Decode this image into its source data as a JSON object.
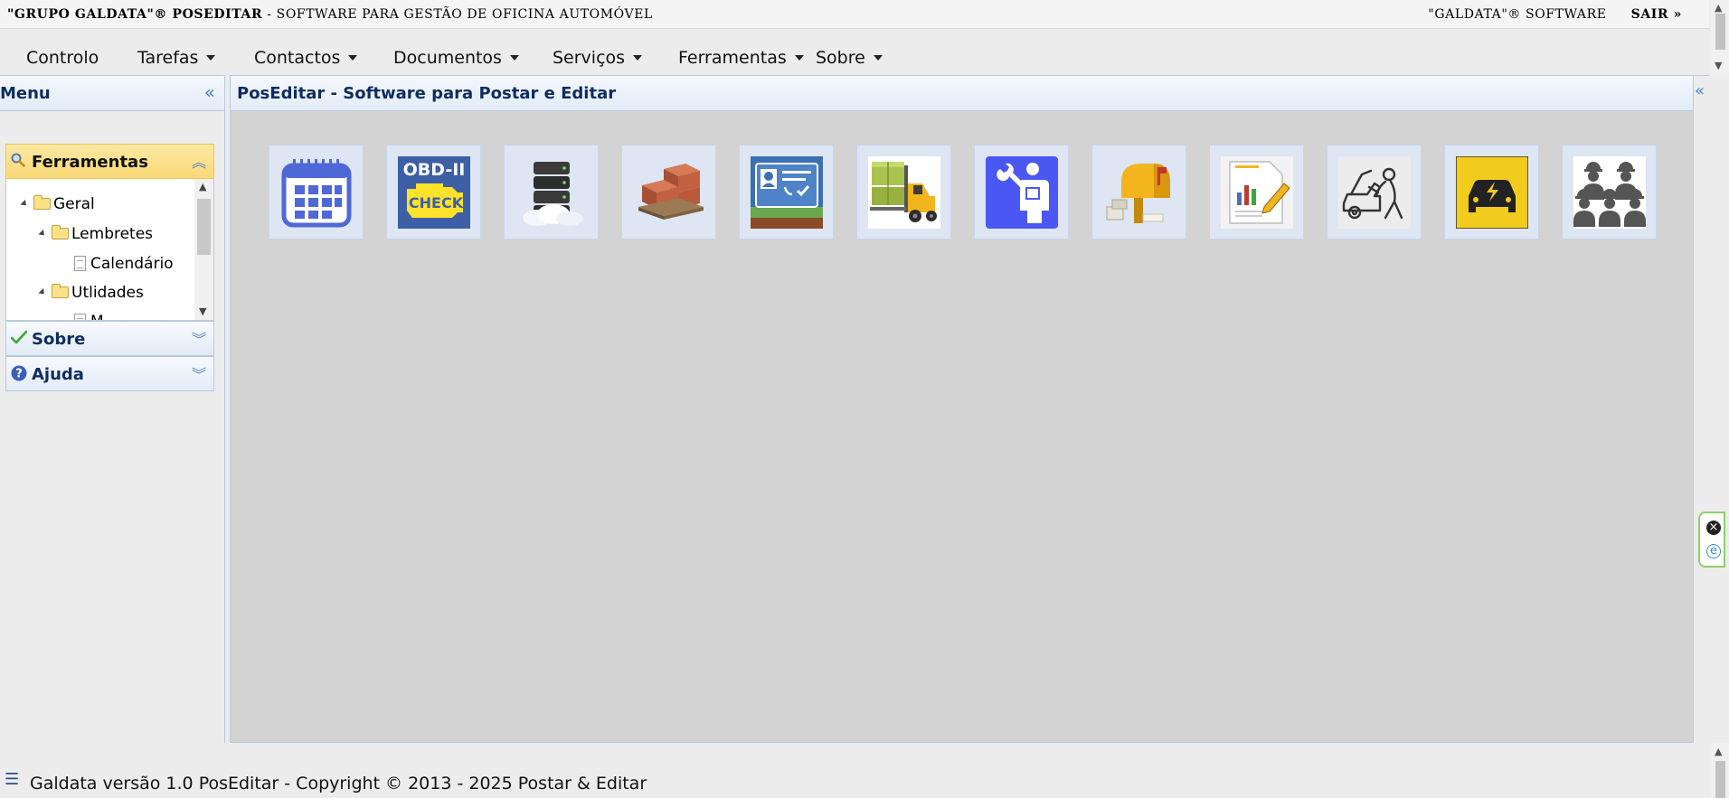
{
  "topbar": {
    "brand": "\"GRUPO GALDATA\"® POSEDITAR",
    "subtitle": " - SOFTWARE PARA GESTÃO DE OFICINA AUTOMÓVEL",
    "vendor": "\"GALDATA\"® SOFTWARE",
    "logout": "SAIR »"
  },
  "nav": [
    {
      "label": "Controlo"
    },
    {
      "label": "Tarefas"
    },
    {
      "label": "Contactos"
    },
    {
      "label": "Documentos"
    },
    {
      "label": "Serviços"
    },
    {
      "label": "Ferramentas"
    },
    {
      "label": "Sobre"
    }
  ],
  "sidebar": {
    "title": "Menu",
    "sections": {
      "ferramentas": "Ferramentas",
      "sobre": "Sobre",
      "ajuda": "Ajuda"
    },
    "tree": [
      "Geral",
      "Lembretes",
      "Calendário",
      "Utlidades",
      "M..."
    ]
  },
  "main": {
    "title": "PosEditar - Software para Postar e Editar",
    "tiles": [
      {
        "icon": "calendar-icon"
      },
      {
        "icon": "obd-check-engine-icon",
        "text_top": "OBD-II",
        "text_bottom": "CHECK"
      },
      {
        "icon": "cloud-server-icon"
      },
      {
        "icon": "boxes-pallet-icon"
      },
      {
        "icon": "contact-card-icon"
      },
      {
        "icon": "forklift-icon"
      },
      {
        "icon": "mechanic-manual-icon"
      },
      {
        "icon": "mailbox-icon"
      },
      {
        "icon": "report-chart-icon"
      },
      {
        "icon": "car-repair-icon"
      },
      {
        "icon": "electric-car-icon"
      },
      {
        "icon": "workers-team-icon"
      }
    ]
  },
  "footer": {
    "text": "Galdata versão 1.0 PosEditar - Copyright © 2013 - 2025 Postar & Editar"
  },
  "colors": {
    "header_text": "#0e2d5f",
    "accent_blue": "#4a7ec2",
    "active_section": "#f9d978",
    "content_bg": "#d3d3d3"
  }
}
